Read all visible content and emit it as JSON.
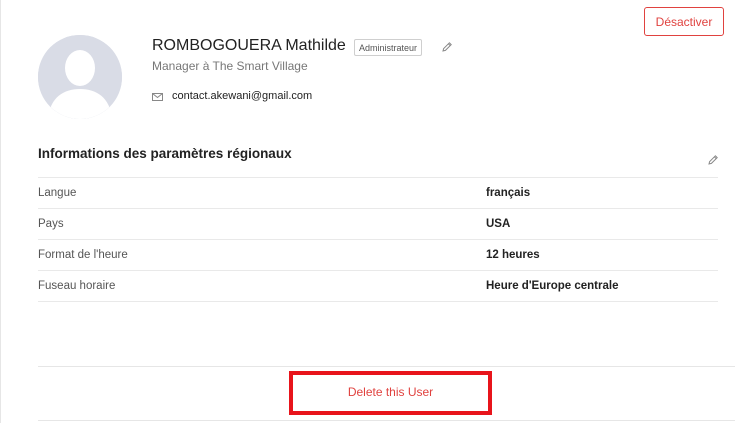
{
  "actions": {
    "deactivate_label": "Désactiver",
    "delete_label": "Delete this User"
  },
  "profile": {
    "name": "ROMBOGOUERA Mathilde",
    "role_badge": "Administrateur",
    "title": "Manager à The Smart Village",
    "email": "contact.akewani@gmail.com",
    "avatar_icon": "default-user-silhouette",
    "email_icon": "mail-icon",
    "edit_icon": "pencil-icon"
  },
  "regional_settings": {
    "title": "Informations des paramètres régionaux",
    "edit_icon": "pencil-icon",
    "rows": [
      {
        "label": "Langue",
        "value": "français"
      },
      {
        "label": "Pays",
        "value": "USA"
      },
      {
        "label": "Format de l'heure",
        "value": "12 heures"
      },
      {
        "label": "Fuseau horaire",
        "value": "Heure d'Europe centrale"
      }
    ]
  },
  "colors": {
    "accent_red": "#e0423f",
    "highlight_red": "#e8141b",
    "avatar_bg": "#d9dce6"
  }
}
